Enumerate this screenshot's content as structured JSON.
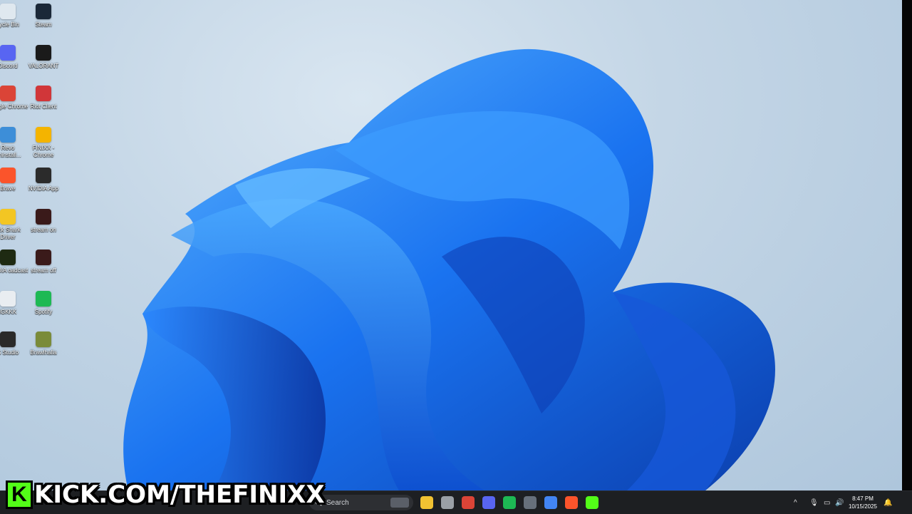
{
  "desktop_icons": [
    {
      "label": "cycle Bin",
      "icon": "recycle-bin-icon",
      "color": "#dfe8ef"
    },
    {
      "label": "Steam",
      "icon": "steam-icon",
      "color": "#1b2838"
    },
    {
      "label": "Discord",
      "icon": "discord-icon",
      "color": "#5865f2"
    },
    {
      "label": "VALORANT",
      "icon": "valorant-icon",
      "color": "#1a1a1a"
    },
    {
      "label": "Google Chrome",
      "icon": "chrome-icon",
      "color": "#db4437"
    },
    {
      "label": "Riot Client",
      "icon": "riot-icon",
      "color": "#d13639"
    },
    {
      "label": "Revo Uninstall...",
      "icon": "revo-icon",
      "color": "#3d8ed8"
    },
    {
      "label": "FINIXX - Chrome",
      "icon": "chrome-profile-icon",
      "color": "#f4b400"
    },
    {
      "label": "Brave",
      "icon": "brave-icon",
      "color": "#fb542b"
    },
    {
      "label": "NVIDIA App",
      "icon": "nvidia-icon",
      "color": "#2b2b2b"
    },
    {
      "label": "ack Shark Driver",
      "icon": "blackshark-icon",
      "color": "#f3c623"
    },
    {
      "label": "stream on",
      "icon": "stream-on-icon",
      "color": "#3a1a1a"
    },
    {
      "label": "NVIDIA oadcast",
      "icon": "nvidia-broadcast-icon",
      "color": "#1e2a12"
    },
    {
      "label": "stream off",
      "icon": "stream-off-icon",
      "color": "#3a1a1a"
    },
    {
      "label": "IGKKK",
      "icon": "blank-file-icon",
      "color": "#e9edf1"
    },
    {
      "label": "Spotify",
      "icon": "spotify-icon",
      "color": "#1db954"
    },
    {
      "label": "S Studio",
      "icon": "obs-icon",
      "color": "#2a2a2a"
    },
    {
      "label": "Brawlhalla",
      "icon": "brawlhalla-icon",
      "color": "#7a8b3a"
    }
  ],
  "taskbar": {
    "search_placeholder": "Search",
    "apps": [
      {
        "name": "file-explorer-icon",
        "color": "#f1c232"
      },
      {
        "name": "task-view-icon",
        "color": "#9aa0a6"
      },
      {
        "name": "chrome-icon",
        "color": "#db4437"
      },
      {
        "name": "discord-icon",
        "color": "#5865f2"
      },
      {
        "name": "spotify-icon",
        "color": "#1db954"
      },
      {
        "name": "steam-icon",
        "color": "#67707b"
      },
      {
        "name": "chrome-profile-icon",
        "color": "#4285f4"
      },
      {
        "name": "brave-icon",
        "color": "#fb542b"
      },
      {
        "name": "kick-icon",
        "color": "#53fc18"
      }
    ],
    "time": "8:47 PM",
    "date": "10/15/2025"
  },
  "overlay": {
    "logo_letter": "K",
    "text": "KICK.COM/THEFINIXX",
    "brand_color": "#53fc18"
  }
}
